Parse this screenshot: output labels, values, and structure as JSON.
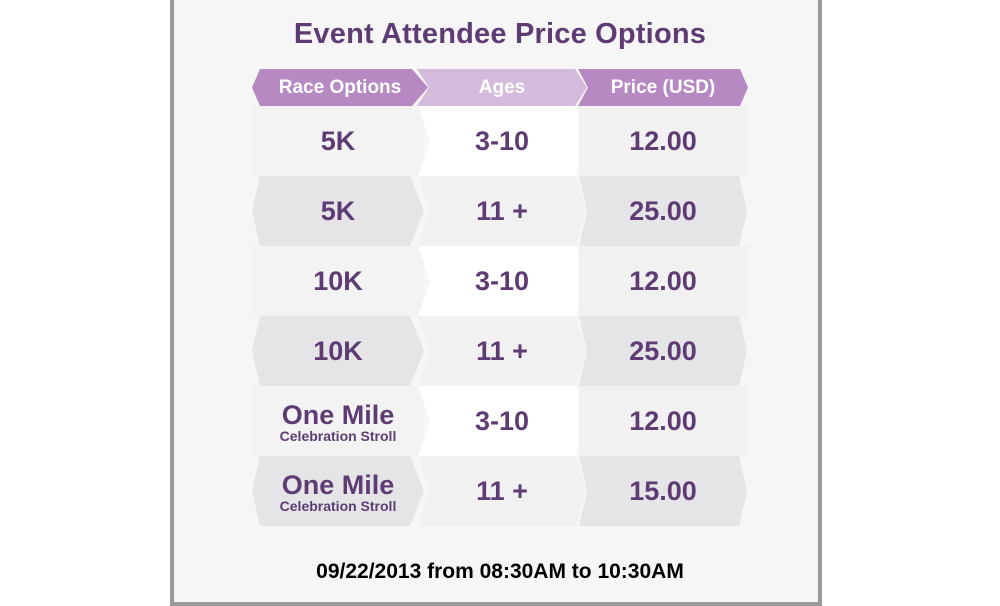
{
  "title": "Event Attendee Price Options",
  "headers": {
    "race": "Race Options",
    "ages": "Ages",
    "price": "Price (USD)"
  },
  "rows": [
    {
      "race": "5K",
      "race_sub": "",
      "ages": "3-10",
      "price": "12.00"
    },
    {
      "race": "5K",
      "race_sub": "",
      "ages": "11 +",
      "price": "25.00"
    },
    {
      "race": "10K",
      "race_sub": "",
      "ages": "3-10",
      "price": "12.00"
    },
    {
      "race": "10K",
      "race_sub": "",
      "ages": "11 +",
      "price": "25.00"
    },
    {
      "race": "One Mile",
      "race_sub": "Celebration Stroll",
      "ages": "3-10",
      "price": "12.00"
    },
    {
      "race": "One Mile",
      "race_sub": "Celebration Stroll",
      "ages": "11 +",
      "price": "15.00"
    }
  ],
  "footer": "09/22/2013 from 08:30AM to 10:30AM",
  "colors": {
    "accent": "#b789c2",
    "accent_light": "#d4bbdc",
    "text": "#5e3c73"
  }
}
